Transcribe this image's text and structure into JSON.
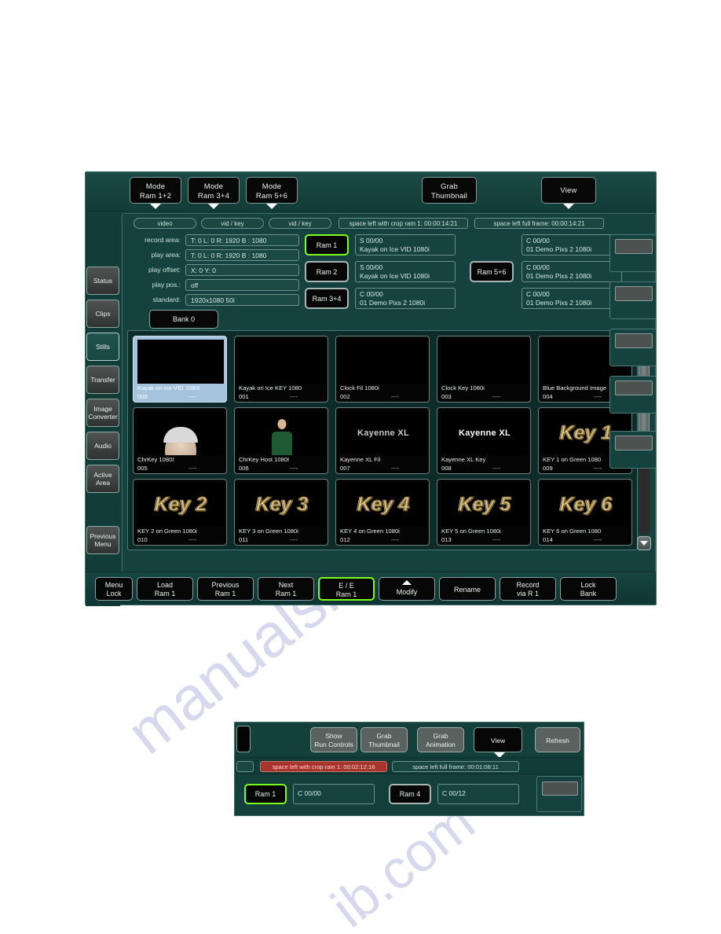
{
  "watermark": {
    "line1": "manualsl",
    "line2": "ib.com"
  },
  "main_panel": {
    "toolbar": {
      "buttons": [
        {
          "name": "mode-ram-1-2",
          "l1": "Mode",
          "l2": "Ram 1+2",
          "has_caret": true
        },
        {
          "name": "mode-ram-3-4",
          "l1": "Mode",
          "l2": "Ram 3+4",
          "has_caret": true
        },
        {
          "name": "mode-ram-5-6",
          "l1": "Mode",
          "l2": "Ram 5+6",
          "has_caret": true
        },
        {
          "name": "grab-thumbnail",
          "l1": "Grab",
          "l2": "Thumbnail",
          "has_caret": false
        },
        {
          "name": "view",
          "l1": "View",
          "l2": "",
          "has_caret": true
        }
      ]
    },
    "sidebar": {
      "items": [
        {
          "label": "Status",
          "active": false
        },
        {
          "label": "Clips",
          "active": false
        },
        {
          "label": "Stills",
          "active": true
        },
        {
          "label": "Transfer",
          "active": false
        },
        {
          "label2": "Image\nConverter",
          "label": "Image Converter",
          "active": false
        },
        {
          "label": "Audio",
          "active": false
        },
        {
          "label": "Active Area",
          "active": false
        },
        {
          "label": "Previous Menu",
          "active": false
        }
      ]
    },
    "tabs": [
      {
        "label": "video"
      },
      {
        "label": "vid / key"
      },
      {
        "label": "vid / key"
      }
    ],
    "info_bars": [
      {
        "label": "space left with crop ram 1: 00:00:14:21"
      },
      {
        "label": "space left full frame: 00:00:14:21"
      }
    ],
    "params": [
      {
        "label": "record area:",
        "value": "T: 0  L: 0  R: 1920  B : 1080"
      },
      {
        "label": "play area:",
        "value": "T: 0  L: 0  R: 1920  B : 1080"
      },
      {
        "label": "play offset:",
        "value": "X: 0  Y: 0"
      },
      {
        "label": "play pos.:",
        "value": "off"
      },
      {
        "label": "standard:",
        "value": "1920x1080 50i"
      }
    ],
    "bank_button": {
      "label": "Bank 0"
    },
    "ram_slots": [
      {
        "name": "ram-1",
        "label": "Ram 1",
        "selected": true,
        "gray": false,
        "code": "S 00/00",
        "clip": "Kayak on Ice VID 1080i"
      },
      {
        "name": "ram-2",
        "label": "Ram 2",
        "selected": false,
        "gray": true,
        "code": "S 00/00",
        "clip": "Kayak on Ice VID 1080i"
      },
      {
        "name": "ram-3-4",
        "label": "Ram 3+4",
        "selected": false,
        "gray": true,
        "code": "C 00/00",
        "clip": "01 Demo Pixs 2 1080i"
      }
    ],
    "ram_slots_right": [
      {
        "name": "ram-1-right",
        "label": "",
        "code": "C 00/00",
        "clip": "01 Demo Pixs 2 1080i"
      },
      {
        "name": "ram-5-6",
        "label": "Ram 5+6",
        "code": "C 00/00",
        "clip": "01 Demo Pixs 2 1080i"
      },
      {
        "name": "ram-3-right",
        "label": "",
        "code": "C 00/00",
        "clip": "01 Demo Pixs 2 1080i"
      }
    ],
    "thumbnails": [
      {
        "name": "still-000",
        "title": "Kayak on Ice VID 1080i",
        "index": "000",
        "dash": "----",
        "selected": true,
        "art": "kayakvid"
      },
      {
        "name": "still-001",
        "title": "Kayak on Ice KEY 1080",
        "index": "001",
        "dash": "----",
        "selected": false,
        "art": "kayakkey"
      },
      {
        "name": "still-002",
        "title": "Clock Fil 1080i",
        "index": "002",
        "dash": "----",
        "selected": false,
        "art": "clockfil"
      },
      {
        "name": "still-003",
        "title": "Clock Key 1080i",
        "index": "003",
        "dash": "----",
        "selected": false,
        "art": "clockkey"
      },
      {
        "name": "still-004",
        "title": "Blue Background Image",
        "index": "004",
        "dash": "----",
        "selected": false,
        "art": "blue"
      },
      {
        "name": "still-005",
        "title": "ChrKey  1080I",
        "index": "005",
        "dash": "----",
        "selected": false,
        "art": "chrkey"
      },
      {
        "name": "still-006",
        "title": "ChrKey Host 1080I",
        "index": "006",
        "dash": "----",
        "selected": false,
        "art": "chrhost"
      },
      {
        "name": "still-007",
        "title": "Kayenne XL Fil",
        "index": "007",
        "dash": "----",
        "selected": false,
        "art": "kayfil",
        "art_text": "Kayenne XL"
      },
      {
        "name": "still-008",
        "title": "Kayenne XL Key",
        "index": "008",
        "dash": "----",
        "selected": false,
        "art": "kaykey",
        "art_text": "Kayenne XL"
      },
      {
        "name": "still-009",
        "title": "KEY 1 on Green 1080",
        "index": "009",
        "dash": "----",
        "selected": false,
        "art": "green",
        "art_text": "Key 1"
      },
      {
        "name": "still-010",
        "title": "KEY 2 on Green 1080i",
        "index": "010",
        "dash": "----",
        "selected": false,
        "art": "green",
        "art_text": "Key 2"
      },
      {
        "name": "still-011",
        "title": "KEY 3 on Green 1080i",
        "index": "011",
        "dash": "----",
        "selected": false,
        "art": "green",
        "art_text": "Key 3"
      },
      {
        "name": "still-012",
        "title": "KEY 4 on Green 1080i",
        "index": "012",
        "dash": "----",
        "selected": false,
        "art": "green",
        "art_text": "Key 4"
      },
      {
        "name": "still-013",
        "title": "KEY 5 on Green 1080i",
        "index": "013",
        "dash": "----",
        "selected": false,
        "art": "green",
        "art_text": "Key 5"
      },
      {
        "name": "still-014",
        "title": "KEY 6 on Green 1080",
        "index": "014",
        "dash": "----",
        "selected": false,
        "art": "green",
        "art_text": "Key 6"
      }
    ],
    "bottom_buttons": [
      {
        "name": "menu-lock",
        "l1": "Menu",
        "l2": "Lock",
        "selected": false,
        "caret": false
      },
      {
        "name": "load-ram-1",
        "l1": "Load",
        "l2": "Ram 1",
        "selected": false,
        "caret": false
      },
      {
        "name": "previous-ram-1",
        "l1": "Previous",
        "l2": "Ram 1",
        "selected": false,
        "caret": false
      },
      {
        "name": "next-ram-1",
        "l1": "Next",
        "l2": "Ram 1",
        "selected": false,
        "caret": false
      },
      {
        "name": "ee-ram-1",
        "l1": "E / E",
        "l2": "Ram 1",
        "selected": true,
        "caret": false
      },
      {
        "name": "modify",
        "l1": "",
        "l2": "Modify",
        "selected": false,
        "caret": true
      },
      {
        "name": "rename",
        "l1": "Rename",
        "l2": "",
        "selected": false,
        "caret": false
      },
      {
        "name": "record-via-r1",
        "l1": "Record",
        "l2": "via R 1",
        "selected": false,
        "caret": false
      },
      {
        "name": "lock-bank",
        "l1": "Lock",
        "l2": "Bank",
        "selected": false,
        "caret": false
      }
    ]
  },
  "inset_panel": {
    "buttons": [
      {
        "name": "show-run-controls",
        "l1": "Show",
        "l2": "Run Controls",
        "style": "gray",
        "caret": false
      },
      {
        "name": "grab-thumbnail",
        "l1": "Grab",
        "l2": "Thumbnail",
        "style": "gray",
        "caret": false
      },
      {
        "name": "grab-animation",
        "l1": "Grab",
        "l2": "Animation",
        "style": "gray",
        "caret": false
      },
      {
        "name": "view",
        "l1": "View",
        "l2": "",
        "style": "dark",
        "caret": true
      },
      {
        "name": "refresh",
        "l1": "Refresh",
        "l2": "",
        "style": "gray",
        "caret": false
      }
    ],
    "status_red": "space left with crop ram 1: 00:02:12:16",
    "status_normal": "space left full frame: 00:01:08:11",
    "ram_slots": [
      {
        "name": "ram-1",
        "label": "Ram 1",
        "selected": true,
        "code": "C 00/00"
      },
      {
        "name": "ram-4",
        "label": "Ram 4",
        "selected": false,
        "code": "C 00/12"
      }
    ]
  },
  "colors": {
    "panel_bg": "#14403c",
    "accent_green": "#7dfa1e",
    "selected_thumb": "#a6c3dd",
    "red_status": "#a8342c",
    "green_chroma": "#16e01a"
  }
}
